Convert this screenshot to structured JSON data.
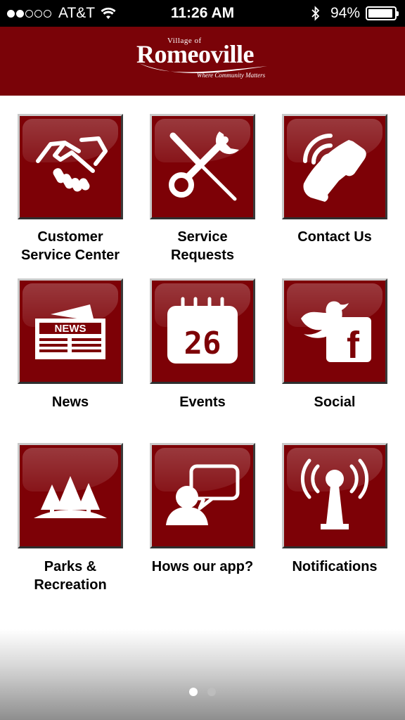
{
  "status_bar": {
    "carrier": "AT&T",
    "signal_bars_filled": 2,
    "signal_bars_total": 5,
    "time": "11:26 AM",
    "battery_percent_label": "94%",
    "battery_level": 0.94
  },
  "header": {
    "logo_top_text": "Village of",
    "logo_name": "Romeoville",
    "logo_tagline": "Where Community Matters",
    "background_color": "#7a0308"
  },
  "tiles": [
    {
      "label_line1": "Customer",
      "label_line2": "Service Center",
      "icon": "handshake-icon"
    },
    {
      "label_line1": "Service",
      "label_line2": "Requests",
      "icon": "tools-icon"
    },
    {
      "label_line1": "Contact Us",
      "label_line2": "",
      "icon": "phone-icon"
    },
    {
      "label_line1": "News",
      "label_line2": "",
      "icon": "newspaper-icon",
      "icon_text": "NEWS"
    },
    {
      "label_line1": "Events",
      "label_line2": "",
      "icon": "calendar-icon",
      "icon_text": "26"
    },
    {
      "label_line1": "Social",
      "label_line2": "",
      "icon": "social-icon",
      "icon_text": "f"
    },
    {
      "label_line1": "Parks &",
      "label_line2": "Recreation",
      "icon": "trees-icon"
    },
    {
      "label_line1": "Hows our app?",
      "label_line2": "",
      "icon": "feedback-icon"
    },
    {
      "label_line1": "Notifications",
      "label_line2": "",
      "icon": "broadcast-tower-icon"
    }
  ],
  "pager": {
    "pages": 2,
    "current": 1
  },
  "colors": {
    "tile": "#7d0106",
    "accent": "#7a0308"
  }
}
